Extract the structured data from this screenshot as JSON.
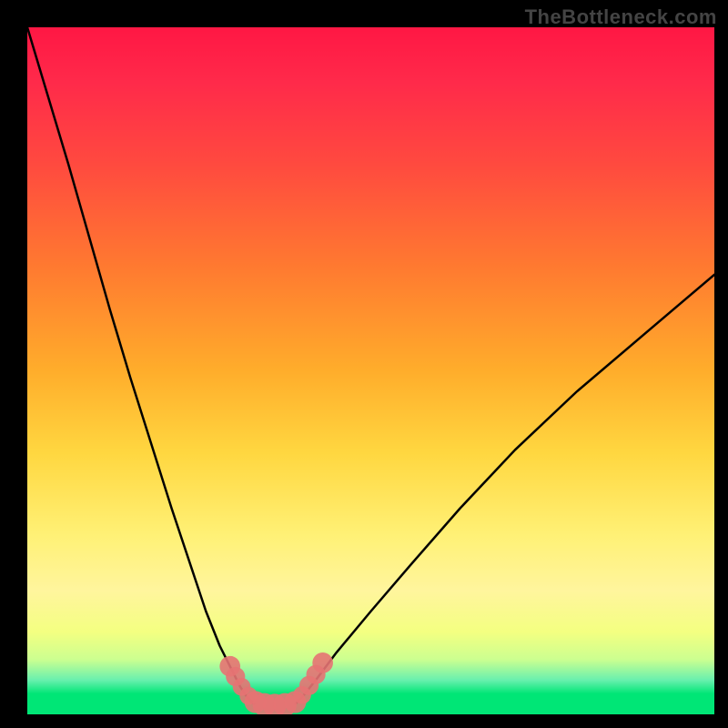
{
  "watermark": "TheBottleneck.com",
  "chart_data": {
    "type": "line",
    "title": "",
    "xlabel": "",
    "ylabel": "",
    "xlim": [
      0,
      100
    ],
    "ylim": [
      0,
      100
    ],
    "grid": false,
    "legend": false,
    "background_gradient": {
      "stops": [
        {
          "pct": 0,
          "color": "#ff1744"
        },
        {
          "pct": 8,
          "color": "#ff2a4a"
        },
        {
          "pct": 20,
          "color": "#ff4a3f"
        },
        {
          "pct": 35,
          "color": "#ff7a30"
        },
        {
          "pct": 50,
          "color": "#ffad2b"
        },
        {
          "pct": 62,
          "color": "#ffd740"
        },
        {
          "pct": 74,
          "color": "#fff176"
        },
        {
          "pct": 82,
          "color": "#fff59d"
        },
        {
          "pct": 88,
          "color": "#f4ff81"
        },
        {
          "pct": 92,
          "color": "#ccff90"
        },
        {
          "pct": 95,
          "color": "#69f0ae"
        },
        {
          "pct": 97,
          "color": "#00e676"
        },
        {
          "pct": 100,
          "color": "#00e676"
        }
      ]
    },
    "series": [
      {
        "name": "bottleneck-curve-left",
        "color": "#000000",
        "stroke_width": 2.5,
        "x": [
          0.0,
          3.0,
          6.0,
          9.0,
          12.0,
          15.0,
          18.0,
          21.0,
          24.0,
          26.0,
          28.0,
          29.5,
          31.0,
          32.0,
          33.0
        ],
        "y": [
          100.0,
          90.0,
          80.0,
          69.5,
          59.0,
          49.0,
          39.5,
          30.0,
          21.0,
          15.0,
          10.0,
          7.0,
          4.0,
          2.5,
          1.5
        ]
      },
      {
        "name": "bottleneck-curve-right",
        "color": "#000000",
        "stroke_width": 2.5,
        "x": [
          39.0,
          40.0,
          42.0,
          45.0,
          50.0,
          56.0,
          63.0,
          71.0,
          80.0,
          90.0,
          100.0
        ],
        "y": [
          1.5,
          2.5,
          5.0,
          9.0,
          15.0,
          22.0,
          30.0,
          38.5,
          47.0,
          55.5,
          64.0
        ]
      }
    ],
    "bottom_marker": {
      "color": "#e57373",
      "opacity": 0.9,
      "dots": [
        {
          "x": 29.5,
          "y": 7.0,
          "r": 1.5
        },
        {
          "x": 30.3,
          "y": 5.5,
          "r": 1.4
        },
        {
          "x": 31.2,
          "y": 4.0,
          "r": 1.3
        },
        {
          "x": 32.2,
          "y": 2.7,
          "r": 1.3
        },
        {
          "x": 33.2,
          "y": 1.8,
          "r": 1.6
        },
        {
          "x": 34.5,
          "y": 1.4,
          "r": 1.7
        },
        {
          "x": 36.0,
          "y": 1.3,
          "r": 1.7
        },
        {
          "x": 37.5,
          "y": 1.4,
          "r": 1.7
        },
        {
          "x": 39.0,
          "y": 1.8,
          "r": 1.6
        },
        {
          "x": 40.0,
          "y": 2.8,
          "r": 1.3
        },
        {
          "x": 41.0,
          "y": 4.2,
          "r": 1.4
        },
        {
          "x": 42.0,
          "y": 5.8,
          "r": 1.4
        },
        {
          "x": 43.0,
          "y": 7.5,
          "r": 1.5
        }
      ]
    }
  }
}
